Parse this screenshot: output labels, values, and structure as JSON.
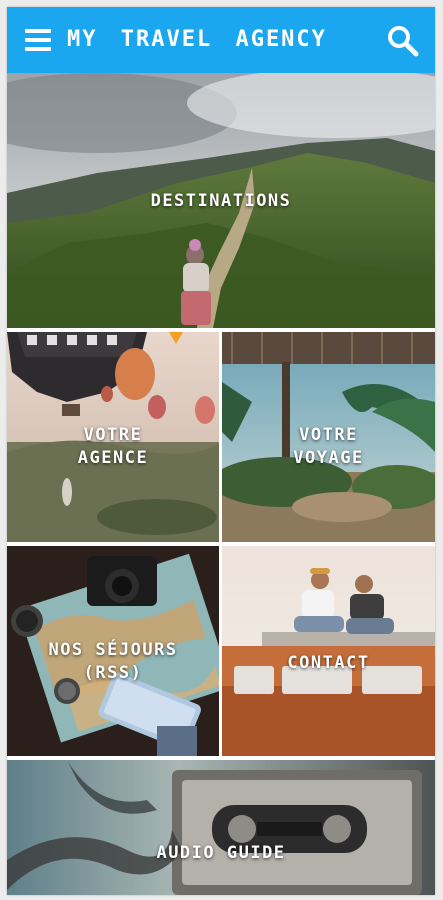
{
  "header": {
    "title": "MY TRAVEL AGENCY",
    "menu_icon": "hamburger-menu-icon",
    "search_icon": "search-icon",
    "background_color": "#1aa7f0"
  },
  "tiles": {
    "destinations": {
      "label": "DESTINATIONS"
    },
    "votre_agence": {
      "line1": "VOTRE",
      "line2": "AGENCE"
    },
    "votre_voyage": {
      "line1": "VOTRE",
      "line2": "VOYAGE"
    },
    "nos_sejours": {
      "line1": "NOS SÉJOURS",
      "line2": "(RSS)"
    },
    "contact": {
      "label": "CONTACT"
    },
    "audio_guide": {
      "label": "AUDIO GUIDE"
    }
  }
}
